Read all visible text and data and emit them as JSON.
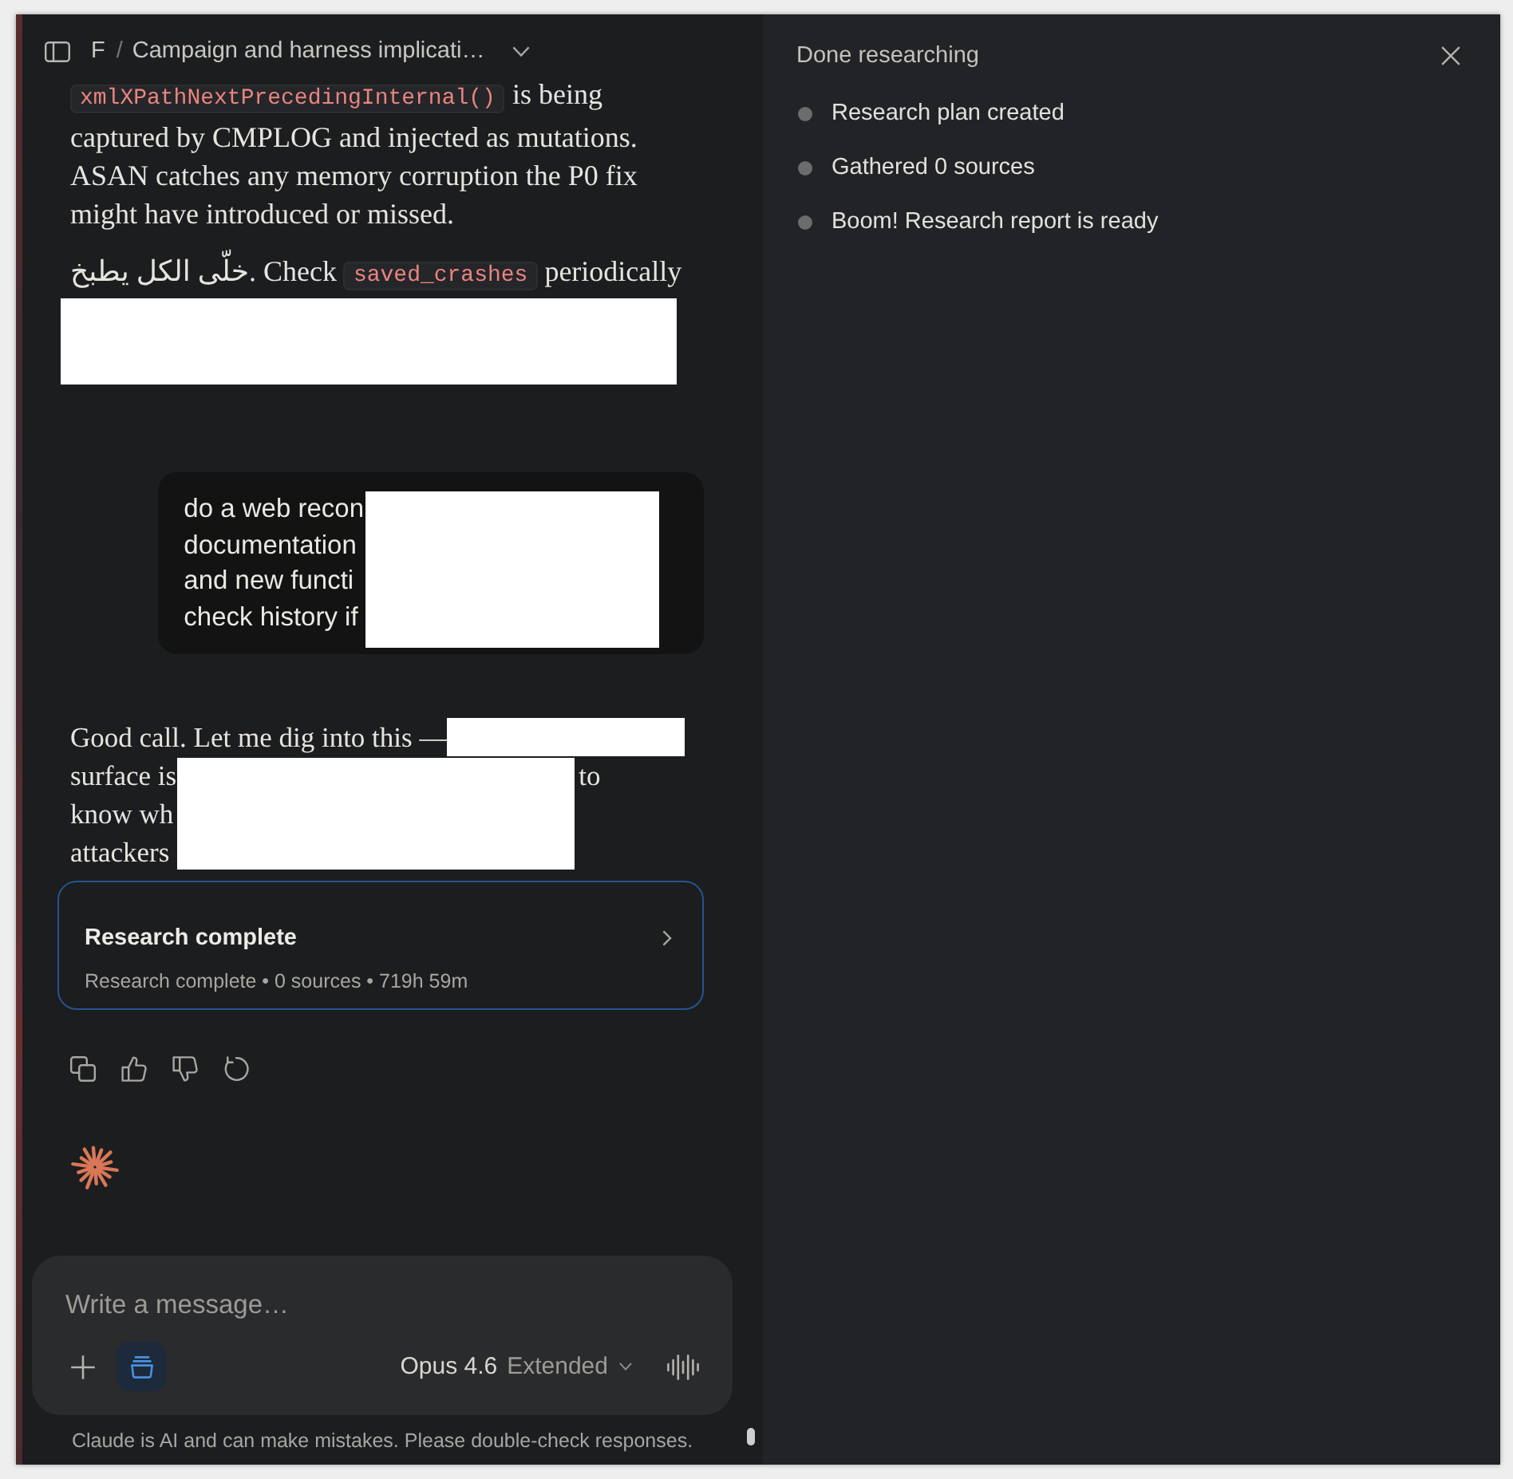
{
  "header": {
    "project": "F",
    "separator": "/",
    "title": "Campaign and harness implicati…"
  },
  "assistant_paragraphs": [
    {
      "redacted": false,
      "segments": [
        {
          "kind": "code",
          "text": "xmlXPathNextPrecedingInternal()"
        },
        {
          "kind": "text",
          "text": " is being captured by CMPLOG and injected as mutations. ASAN catches any memory corruption the P0 fix might have introduced or missed."
        }
      ]
    },
    {
      "redacted": true,
      "segments": [
        {
          "kind": "text",
          "text": "خلّى الكل يطبخ. Check "
        },
        {
          "kind": "code",
          "text": "saved_crashes"
        },
        {
          "kind": "text",
          "text": " periodically"
        }
      ]
    }
  ],
  "user_message": {
    "redacted": true,
    "lines": [
      "do a web recon",
      "documentation",
      "and new functi",
      "check history if"
    ]
  },
  "reply": {
    "redacted": true,
    "lines": [
      {
        "text": "Good call. Let me dig into this —"
      },
      {
        "text": "surface is",
        "after": "to"
      },
      {
        "text": "know wh"
      },
      {
        "text": "attackers"
      }
    ]
  },
  "research_card": {
    "title": "Research complete",
    "summary": "Research complete • 0 sources • 719h 59m"
  },
  "message_actions": [
    {
      "kind": "copy"
    },
    {
      "kind": "like"
    },
    {
      "kind": "dislike"
    },
    {
      "kind": "retry"
    }
  ],
  "composer": {
    "placeholder": "Write a message…",
    "research_on": true,
    "model": "Opus 4.6",
    "mode": "Extended"
  },
  "disclaimer": "Claude is AI and can make mistakes. Please double-check responses.",
  "research_panel": {
    "title": "Done researching",
    "steps": [
      {
        "label": "Research plan created"
      },
      {
        "label": "Gathered 0 sources"
      },
      {
        "label": "Boom! Research report is ready"
      }
    ]
  }
}
